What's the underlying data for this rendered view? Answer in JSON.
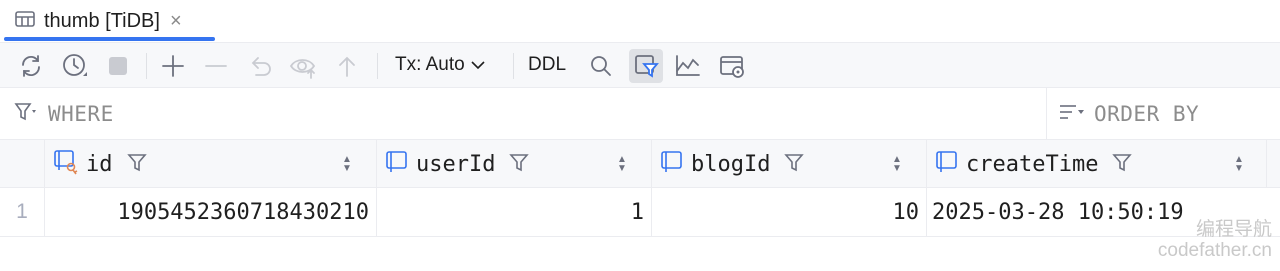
{
  "tab": {
    "title": "thumb [TiDB]",
    "close": "×",
    "icon": "table-icon"
  },
  "toolbar": {
    "tx_label": "Tx: Auto",
    "ddl_label": "DDL",
    "icons": [
      "refresh-icon",
      "history-icon",
      "stop-icon",
      "add-row-icon",
      "delete-row-icon",
      "revert-icon",
      "preview-icon",
      "submit-icon",
      "search-icon",
      "filter-toggle-icon",
      "chart-icon",
      "view-settings-icon"
    ]
  },
  "filter": {
    "where_label": "WHERE",
    "order_label": "ORDER BY"
  },
  "table": {
    "columns": [
      {
        "name": "id",
        "key": true
      },
      {
        "name": "userId",
        "key": false
      },
      {
        "name": "blogId",
        "key": false
      },
      {
        "name": "createTime",
        "key": false
      }
    ],
    "rows": [
      {
        "num": "1",
        "id": "1905452360718430210",
        "userId": "1",
        "blogId": "10",
        "createTime": "2025-03-28 10:50:19"
      }
    ]
  },
  "watermark": {
    "line1": "编程导航",
    "line2": "codefather.cn"
  },
  "colors": {
    "accent": "#3574f0",
    "toolbar_bg": "#f7f8fa",
    "header_bg": "#f7f8fa",
    "key_icon": "#e08855"
  }
}
